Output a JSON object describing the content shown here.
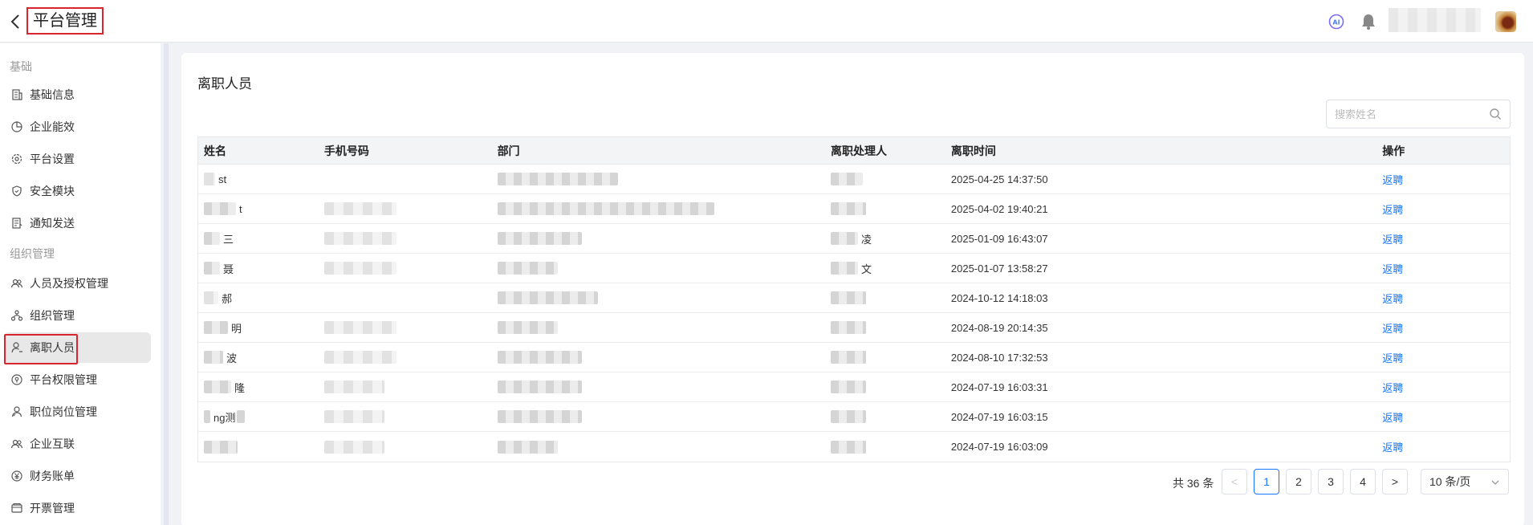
{
  "header": {
    "title": "平台管理"
  },
  "sidebar": {
    "sections": [
      {
        "label": "基础"
      },
      {
        "label": "组织管理"
      }
    ],
    "items": [
      {
        "label": "基础信息",
        "icon": "building-icon"
      },
      {
        "label": "企业能效",
        "icon": "chart-pie-icon"
      },
      {
        "label": "平台设置",
        "icon": "gear-icon"
      },
      {
        "label": "安全模块",
        "icon": "shield-icon"
      },
      {
        "label": "通知发送",
        "icon": "notice-icon"
      },
      {
        "label": "人员及授权管理",
        "icon": "users-icon"
      },
      {
        "label": "组织管理",
        "icon": "org-icon"
      },
      {
        "label": "离职人员",
        "icon": "user-leave-icon",
        "active": true
      },
      {
        "label": "平台权限管理",
        "icon": "permission-icon"
      },
      {
        "label": "职位岗位管理",
        "icon": "position-icon"
      },
      {
        "label": "企业互联",
        "icon": "link-users-icon"
      },
      {
        "label": "财务账单",
        "icon": "yuan-icon"
      },
      {
        "label": "开票管理",
        "icon": "invoice-icon"
      }
    ]
  },
  "main": {
    "title": "离职人员",
    "search": {
      "placeholder": "搜索姓名",
      "value": ""
    },
    "table": {
      "columns": [
        "姓名",
        "手机号码",
        "部门",
        "离职处理人",
        "离职时间",
        "操作"
      ],
      "rows": [
        {
          "name": "st",
          "time": "2025-04-25 14:37:50",
          "action": "返聘"
        },
        {
          "name": "t",
          "time": "2025-04-02 19:40:21",
          "action": "返聘"
        },
        {
          "name": "三",
          "time": "2025-01-09 16:43:07",
          "action": "返聘"
        },
        {
          "name": "聂",
          "time": "2025-01-07 13:58:27",
          "action": "返聘"
        },
        {
          "name": "郝",
          "time": "2024-10-12 14:18:03",
          "action": "返聘"
        },
        {
          "name": "明",
          "time": "2024-08-19 20:14:35",
          "action": "返聘"
        },
        {
          "name": "波",
          "time": "2024-08-10 17:32:53",
          "action": "返聘"
        },
        {
          "name": "隆",
          "time": "2024-07-19 16:03:31",
          "action": "返聘"
        },
        {
          "name": "ng测",
          "time": "2024-07-19 16:03:15",
          "action": "返聘"
        },
        {
          "name": "",
          "time": "2024-07-19 16:03:09",
          "action": "返聘"
        }
      ]
    },
    "pagination": {
      "total_label": "共 36 条",
      "prev": "<",
      "next": ">",
      "pages": [
        "1",
        "2",
        "3",
        "4"
      ],
      "current": "1",
      "page_size": "10 条/页"
    }
  },
  "colors": {
    "accent": "#1677ff",
    "highlight_box": "#d9262e"
  }
}
